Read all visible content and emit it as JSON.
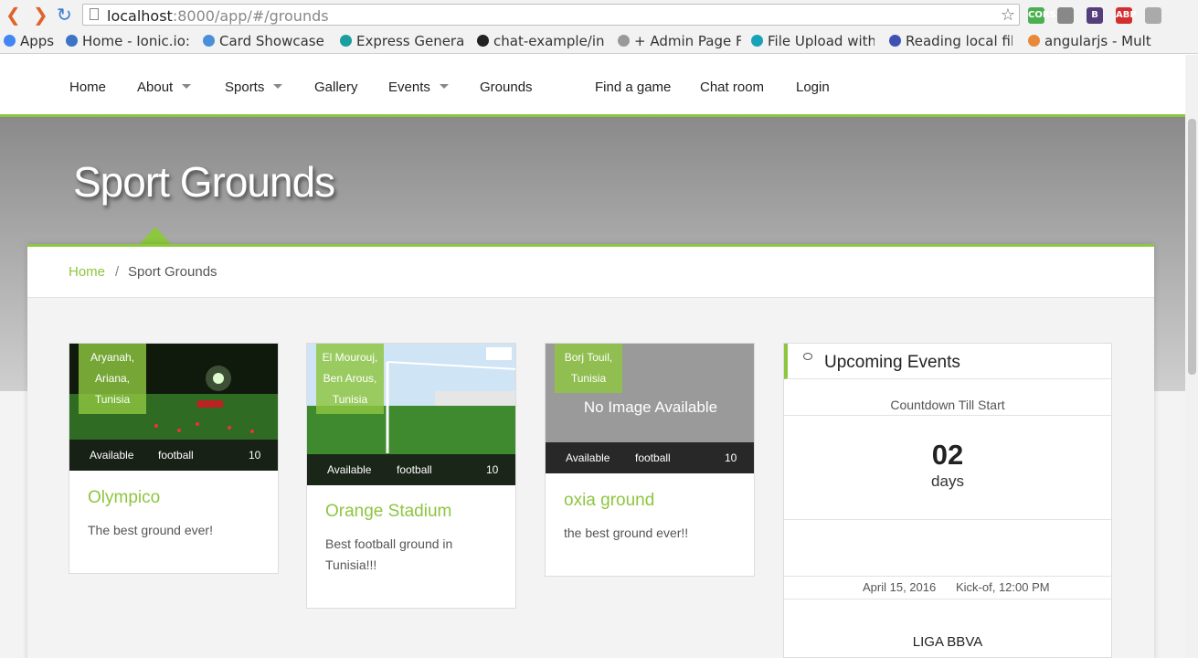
{
  "browser": {
    "url_host": "localhost",
    "url_rest": ":8000/app/#/grounds",
    "bookmarks": [
      {
        "label": "Apps",
        "color": "#4285f4"
      },
      {
        "label": "Home - Ionic.io: t",
        "color": "#3b73c7"
      },
      {
        "label": "Card Showcase - ",
        "color": "#4a90d9"
      },
      {
        "label": "Express Generato",
        "color": "#1a9ea0"
      },
      {
        "label": "chat-example/inc",
        "color": "#222222"
      },
      {
        "label": "+ Admin Page Fin",
        "color": "#999999"
      },
      {
        "label": "File Upload with ",
        "color": "#17a2b8"
      },
      {
        "label": "Reading local file",
        "color": "#3f51b5"
      },
      {
        "label": "angularjs - Multip",
        "color": "#e8883a"
      }
    ],
    "extensions": [
      {
        "label": "CORS",
        "color": "#4caf50"
      },
      {
        "label": "",
        "color": "#888888"
      },
      {
        "label": "B",
        "color": "#563d7c"
      },
      {
        "label": "ABP",
        "color": "#d32f2f"
      },
      {
        "label": "",
        "color": "#aaaaaa"
      }
    ]
  },
  "nav": {
    "items": [
      {
        "label": "Home",
        "dropdown": false
      },
      {
        "label": "About",
        "dropdown": true
      },
      {
        "label": "Sports",
        "dropdown": true
      },
      {
        "label": "Gallery",
        "dropdown": false
      },
      {
        "label": "Events",
        "dropdown": true
      },
      {
        "label": "Grounds",
        "dropdown": false
      },
      {
        "label": "Find a game",
        "dropdown": false
      },
      {
        "label": "Chat room",
        "dropdown": false
      },
      {
        "label": "Login",
        "dropdown": false
      }
    ]
  },
  "hero": {
    "title": "Sport Grounds"
  },
  "breadcrumb": {
    "home": "Home",
    "separator": "/",
    "current": "Sport Grounds"
  },
  "colors": {
    "accent": "#8dc63f"
  },
  "grounds": [
    {
      "location": [
        "Aryanah,",
        "Ariana,",
        "Tunisia"
      ],
      "status": "Available",
      "sport": "football",
      "capacity": "10",
      "name": "Olympico",
      "description": "The best ground ever!",
      "image": "night-field"
    },
    {
      "location": [
        "El Mourouj,",
        "Ben Arous,",
        "Tunisia"
      ],
      "status": "Available",
      "sport": "football",
      "capacity": "10",
      "name": "Orange Stadium",
      "description": "Best football ground in Tunisia!!!",
      "image": "day-field"
    },
    {
      "location": [
        "Borj Touil,",
        "Tunisia"
      ],
      "status": "Available",
      "sport": "football",
      "capacity": "10",
      "name": "oxia ground",
      "description": "the best ground ever!!",
      "image": "none",
      "no_image_text": "No Image Available"
    }
  ],
  "events": {
    "title": "Upcoming Events",
    "countdown_label": "Countdown Till Start",
    "countdown_value": "02",
    "countdown_unit": "days",
    "event_date": "April 15, 2016",
    "event_kickoff": "Kick-of, 12:00 PM",
    "event_name": "LIGA BBVA"
  }
}
